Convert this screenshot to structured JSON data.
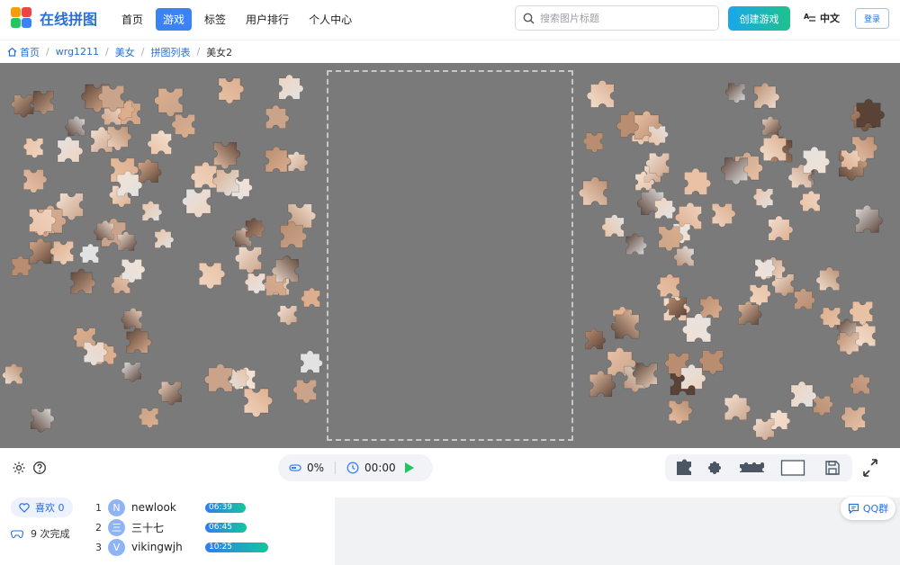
{
  "app": {
    "logo_text": "在线拼图"
  },
  "nav": {
    "items": [
      "首页",
      "游戏",
      "标签",
      "用户排行",
      "个人中心"
    ],
    "active": "游戏"
  },
  "search": {
    "placeholder": "搜索图片标题",
    "value": ""
  },
  "header": {
    "create_label": "创建游戏",
    "language_label": "中文",
    "login_label": "登录"
  },
  "breadcrumb": [
    "首页",
    "wrg1211",
    "美女",
    "拼图列表",
    "美女2"
  ],
  "status": {
    "progress": "0%",
    "timer": "00:00"
  },
  "social": {
    "likes_label": "喜欢 0",
    "completions_label": "9 次完成",
    "qq_label": "QQ群"
  },
  "leaderboard": [
    {
      "rank": "1",
      "avatar": "N",
      "name": "newlook",
      "time": "06:39",
      "bar_fraction": 0.64
    },
    {
      "rank": "2",
      "avatar": "三",
      "name": "三十七",
      "time": "06:45",
      "bar_fraction": 0.65
    },
    {
      "rank": "3",
      "avatar": "V",
      "name": "vikingwjh",
      "time": "10:25",
      "bar_fraction": 1.0
    }
  ],
  "colors": {
    "brand": "#2a6fdb",
    "active_nav": "#3b82f6",
    "board_bg": "#7a7a7a",
    "play": "#22c55e",
    "skin_tone": "#e9c2a6"
  }
}
